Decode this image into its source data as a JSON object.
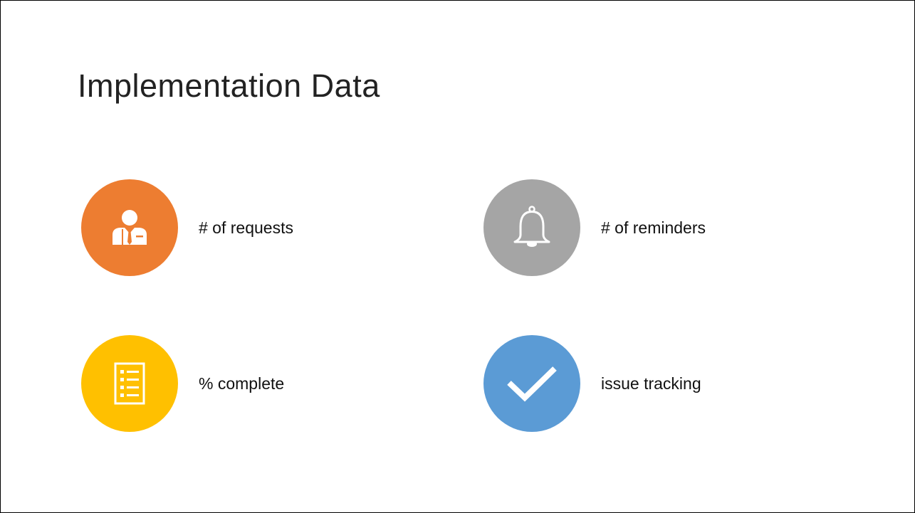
{
  "slide": {
    "title": "Implementation Data"
  },
  "items": [
    {
      "label": "# of requests",
      "icon": "businessman-icon",
      "color": "#ED7D31"
    },
    {
      "label": "# of reminders",
      "icon": "bell-icon",
      "color": "#A5A5A5"
    },
    {
      "label": "% complete",
      "icon": "checklist-icon",
      "color": "#FFC000"
    },
    {
      "label": "issue tracking",
      "icon": "checkmark-icon",
      "color": "#5B9BD5"
    }
  ]
}
